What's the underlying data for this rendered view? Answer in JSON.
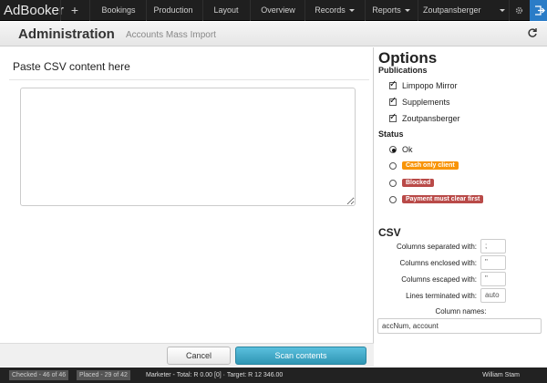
{
  "app": {
    "brand": "AdBooker",
    "add_symbol": "+"
  },
  "nav": {
    "items": [
      {
        "label": "Bookings",
        "dropdown": false
      },
      {
        "label": "Production",
        "dropdown": false
      },
      {
        "label": "Layout",
        "dropdown": false
      },
      {
        "label": "Overview",
        "dropdown": false
      },
      {
        "label": "Records",
        "dropdown": true
      },
      {
        "label": "Reports",
        "dropdown": true
      },
      {
        "label": "Zoutpansberger",
        "dropdown": true
      }
    ],
    "icons": [
      "gear-icon",
      "logout-icon"
    ],
    "accent": "#2a7cc7"
  },
  "header": {
    "title": "Administration",
    "subtitle": "Accounts Mass Import",
    "refresh_icon": "refresh-icon"
  },
  "main": {
    "paste_title": "Paste CSV content here",
    "csv_value": "",
    "cancel_label": "Cancel",
    "scan_label": "Scan contents"
  },
  "options": {
    "title": "Options",
    "publications_label": "Publications",
    "publications": [
      {
        "label": "Limpopo Mirror",
        "checked": true
      },
      {
        "label": "Supplements",
        "checked": true
      },
      {
        "label": "Zoutpansberger",
        "checked": true
      }
    ],
    "status_label": "Status",
    "statuses": [
      {
        "label": "Ok",
        "selected": true,
        "badge": null
      },
      {
        "label": "Cash only client",
        "selected": false,
        "badge": "#f89406"
      },
      {
        "label": "Blocked",
        "selected": false,
        "badge": "#b94a48"
      },
      {
        "label": "Payment must clear first",
        "selected": false,
        "badge": "#b94a48"
      }
    ],
    "csv_title": "CSV",
    "fields": [
      {
        "label": "Columns separated with:",
        "value": ";"
      },
      {
        "label": "Columns enclosed with:",
        "value": "\""
      },
      {
        "label": "Columns escaped with:",
        "value": "\""
      },
      {
        "label": "Lines terminated with:",
        "value": "auto"
      }
    ],
    "column_names_label": "Column names:",
    "column_names_value": "accNum, account"
  },
  "statusbar": {
    "checked": "Checked - 46 of 46",
    "placed": "Placed - 29 of 42",
    "marketer": "Marketer - Total: R 0.00 [0] · Target: R 12 346.00",
    "user": "William Stam"
  }
}
